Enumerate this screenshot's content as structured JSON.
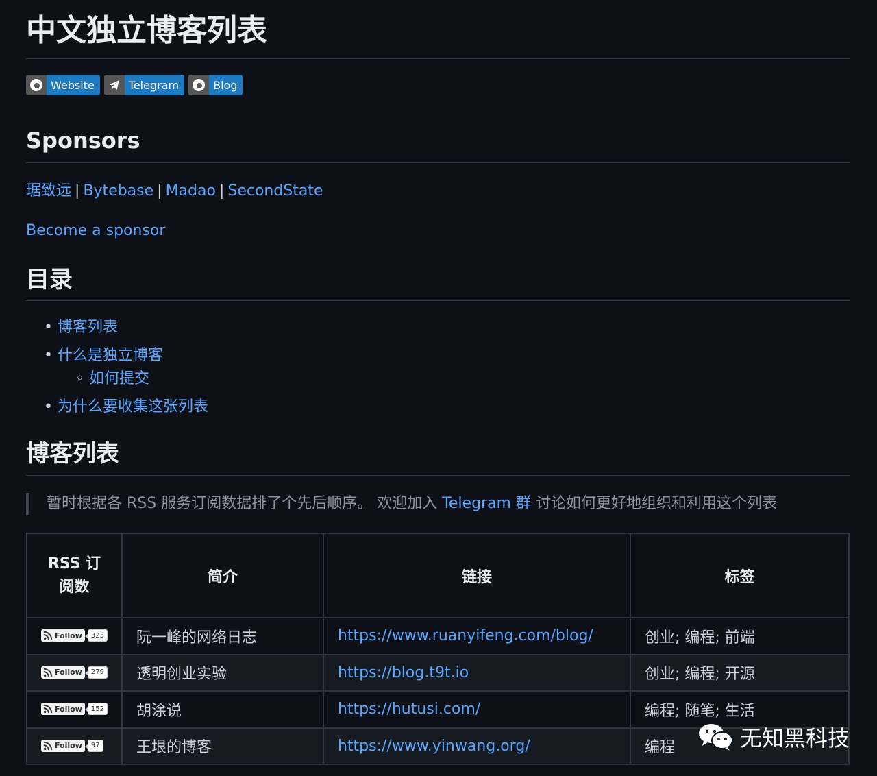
{
  "title": "中文独立博客列表",
  "badges": [
    {
      "icon": "chrome-icon",
      "label": "Website"
    },
    {
      "icon": "telegram-icon",
      "label": "Telegram"
    },
    {
      "icon": "chrome-icon",
      "label": "Blog"
    }
  ],
  "sponsors": {
    "heading": "Sponsors",
    "links": [
      "琚致远",
      "Bytebase",
      "Madao",
      "SecondState"
    ],
    "separator": "|",
    "become": "Become a sponsor"
  },
  "toc": {
    "heading": "目录",
    "items": [
      "博客列表",
      "什么是独立博客",
      "如何提交",
      "为什么要收集这张列表"
    ]
  },
  "blog_list": {
    "heading": "博客列表",
    "quote_pre": "暂时根据各 RSS 服务订阅数据排了个先后顺序。 欢迎加入 ",
    "quote_link": "Telegram 群",
    "quote_post": " 讨论如何更好地组织和利用这个列表",
    "columns": [
      "RSS 订阅数",
      "简介",
      "链接",
      "标签"
    ],
    "follow_label": "Follow",
    "rows": [
      {
        "count": "323",
        "name": "阮一峰的网络日志",
        "url": "https://www.ruanyifeng.com/blog/",
        "tags": "创业; 编程; 前端"
      },
      {
        "count": "279",
        "name": "透明创业实验",
        "url": "https://blog.t9t.io",
        "tags": "创业; 编程; 开源"
      },
      {
        "count": "152",
        "name": "胡涂说",
        "url": "https://hutusi.com/",
        "tags": "编程; 随笔; 生活"
      },
      {
        "count": "97",
        "name": "王垠的博客",
        "url": "https://www.yinwang.org/",
        "tags": "编程"
      }
    ]
  },
  "watermark": "无知黑科技",
  "colors": {
    "background": "#0d1117",
    "link": "#58a6ff",
    "badge": "#1f7bc1"
  }
}
